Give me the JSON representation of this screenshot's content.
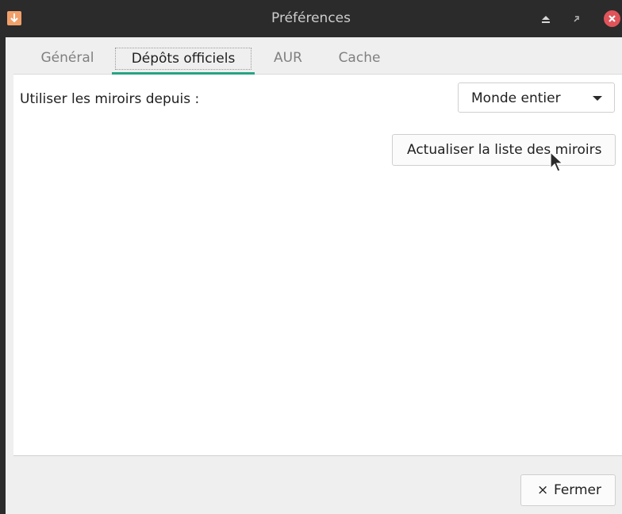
{
  "window": {
    "title": "Préférences",
    "icons": [
      "download-arrow-icon",
      "eject-icon",
      "restore-icon",
      "close-icon"
    ]
  },
  "tabs": [
    {
      "label": "Général",
      "active": false
    },
    {
      "label": "Dépôts officiels",
      "active": true
    },
    {
      "label": "AUR",
      "active": false
    },
    {
      "label": "Cache",
      "active": false
    }
  ],
  "mirrors": {
    "label": "Utiliser les miroirs depuis :",
    "selected": "Monde entier",
    "refresh_label": "Actualiser la liste des miroirs"
  },
  "footer": {
    "close_symbol": "×",
    "close_label": "Fermer"
  },
  "colors": {
    "accent": "#26a383",
    "titlebar": "#2b2b2b",
    "close_button": "#e0545a",
    "app_icon": "#f1a06b"
  }
}
